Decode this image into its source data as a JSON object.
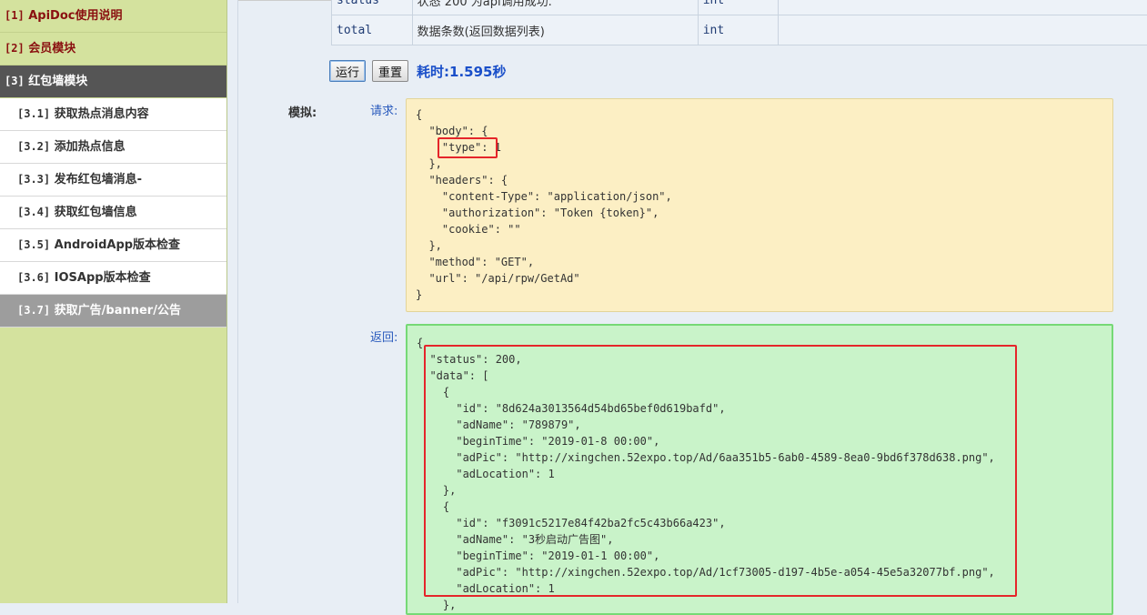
{
  "sidebar": {
    "items": [
      {
        "num": "[1]",
        "label": "ApiDoc使用说明"
      },
      {
        "num": "[2]",
        "label": "会员模块"
      },
      {
        "num": "[3]",
        "label": "红包墙模块"
      }
    ],
    "sub_items": [
      {
        "num": "[3.1]",
        "label": "获取热点消息内容"
      },
      {
        "num": "[3.2]",
        "label": "添加热点信息"
      },
      {
        "num": "[3.3]",
        "label": "发布红包墙消息-"
      },
      {
        "num": "[3.4]",
        "label": "获取红包墙信息"
      },
      {
        "num": "[3.5]",
        "label": "AndroidApp版本检查"
      },
      {
        "num": "[3.6]",
        "label": "IOSApp版本检查"
      },
      {
        "num": "[3.7]",
        "label": "获取广告/banner/公告"
      }
    ]
  },
  "params_table": {
    "rows": [
      {
        "name": "status",
        "desc": "状态 200 为api调用成功.",
        "type": "int",
        "extra": ""
      },
      {
        "name": "total",
        "desc": "数据条数(返回数据列表)",
        "type": "int",
        "extra": ""
      }
    ]
  },
  "actions": {
    "run_label": "运行",
    "reset_label": "重置",
    "timing": "耗时:1.595秒"
  },
  "mock": {
    "label": "模拟:",
    "request_label": "请求:",
    "response_label": "返回:",
    "request_code": "{\n  \"body\": {\n    \"type\": 1\n  },\n  \"headers\": {\n    \"content-Type\": \"application/json\",\n    \"authorization\": \"Token {token}\",\n    \"cookie\": \"\"\n  },\n  \"method\": \"GET\",\n  \"url\": \"/api/rpw/GetAd\"\n}",
    "response_code": "{\n  \"status\": 200,\n  \"data\": [\n    {\n      \"id\": \"8d624a3013564d54bd65bef0d619bafd\",\n      \"adName\": \"789879\",\n      \"beginTime\": \"2019-01-8 00:00\",\n      \"adPic\": \"http://xingchen.52expo.top/Ad/6aa351b5-6ab0-4589-8ea0-9bd6f378d638.png\",\n      \"adLocation\": 1\n    },\n    {\n      \"id\": \"f3091c5217e84f42ba2fc5c43b66a423\",\n      \"adName\": \"3秒启动广告图\",\n      \"beginTime\": \"2019-01-1 00:00\",\n      \"adPic\": \"http://xingchen.52expo.top/Ad/1cf73005-d197-4b5e-a054-45e5a32077bf.png\",\n      \"adLocation\": 1\n    },"
  },
  "colors": {
    "sidebar_bg": "#d4e29e",
    "active_group_bg": "#555555",
    "selected_item_bg": "#9d9d9d",
    "request_bg": "#fcefc4",
    "response_bg": "#c9f3c9",
    "highlight": "#e5252a",
    "timing_text": "#1a4fc9"
  }
}
